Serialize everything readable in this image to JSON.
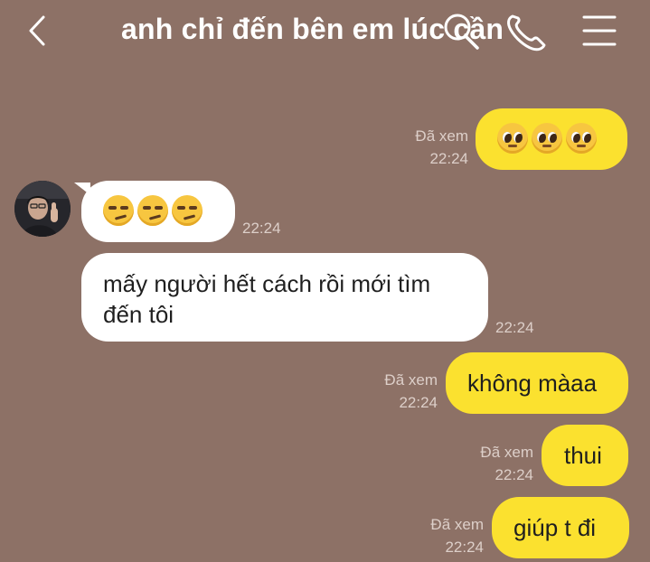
{
  "header": {
    "title": "anh chỉ đến bên em lúc cần"
  },
  "messages": [
    {
      "id": "m1",
      "side": "me",
      "content_type": "emoji",
      "emoji": "pleading-face",
      "emoji_count": 3,
      "status": "Đã xem",
      "time": "22:24"
    },
    {
      "id": "m2",
      "side": "them",
      "content_type": "emoji",
      "emoji": "smirking-face",
      "emoji_count": 3,
      "time": "22:24"
    },
    {
      "id": "m3",
      "side": "them",
      "content_type": "text",
      "text_line1": "mấy người hết cách rồi mới tìm",
      "text_line2": "đến tôi",
      "time": "22:24"
    },
    {
      "id": "m4",
      "side": "me",
      "content_type": "text",
      "text": "không màaa",
      "status": "Đã xem",
      "time": "22:24"
    },
    {
      "id": "m5",
      "side": "me",
      "content_type": "text",
      "text": "thui",
      "status": "Đã xem",
      "time": "22:24"
    },
    {
      "id": "m6",
      "side": "me",
      "content_type": "text",
      "text": "giúp t đi",
      "status": "Đã xem",
      "time": "22:24"
    }
  ],
  "colors": {
    "background": "#8d7166",
    "my_bubble": "#fbe12f",
    "their_bubble": "#ffffff",
    "meta_text": "#ddcfc9",
    "header_text": "#ffffff"
  },
  "icons": [
    "back-chevron",
    "search",
    "phone-call",
    "menu-hamburger"
  ]
}
